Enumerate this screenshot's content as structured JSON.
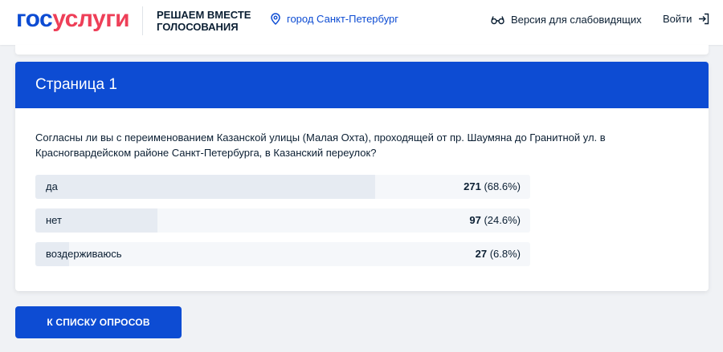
{
  "header": {
    "logo_part1": "гос",
    "logo_part2": "услуги",
    "tagline": "РЕШАЕМ ВМЕСТЕ ГОЛОСОВАНИЯ",
    "location": "город Санкт-Петербург",
    "vision": "Версия для слабовидящих",
    "login": "Войти"
  },
  "card": {
    "title": "Страница 1",
    "question": "Согласны ли вы с переименованием Казанской улицы (Малая Охта), проходящей от пр. Шаумяна до Гранитной ул. в Красногвардейском районе Санкт-Петербурга, в Казанский переулок?",
    "options": [
      {
        "label": "да",
        "count": "271",
        "percent": "(68.6%)",
        "share": 0.686
      },
      {
        "label": "нет",
        "count": "97",
        "percent": "(24.6%)",
        "share": 0.246
      },
      {
        "label": "воздерживаюсь",
        "count": "27",
        "percent": "(6.8%)",
        "share": 0.068
      }
    ]
  },
  "back_button": "К списку опросов",
  "icons": {
    "location": "location-pin-icon",
    "vision": "glasses-icon",
    "login": "login-arrow-icon"
  },
  "colors": {
    "brand_blue": "#0d4cd3",
    "brand_red": "#ee3f58",
    "bar_fill": "#e6ebf2",
    "bar_track": "#f5f7fa"
  }
}
